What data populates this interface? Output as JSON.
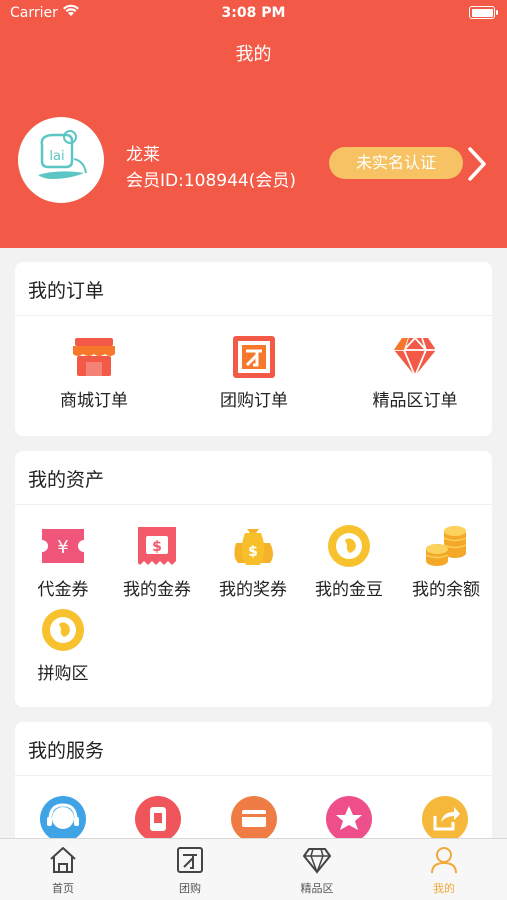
{
  "status_bar": {
    "carrier": "Carrier",
    "time": "3:08 PM"
  },
  "header": {
    "title": "我的"
  },
  "user": {
    "name": "龙莱",
    "member_id": "会员ID:108944(会员)",
    "verify_label": "未实名认证",
    "avatar_text": "lai"
  },
  "orders": {
    "title": "我的订单",
    "items": [
      {
        "label": "商城订单",
        "icon": "shop-icon"
      },
      {
        "label": "团购订单",
        "icon": "group-buy-icon"
      },
      {
        "label": "精品区订单",
        "icon": "diamond-icon"
      }
    ]
  },
  "assets": {
    "title": "我的资产",
    "items": [
      {
        "label": "代金券",
        "icon": "voucher-icon"
      },
      {
        "label": "我的金券",
        "icon": "gold-ticket-icon"
      },
      {
        "label": "我的奖券",
        "icon": "money-bags-icon"
      },
      {
        "label": "我的金豆",
        "icon": "gold-bean-icon"
      },
      {
        "label": "我的余额",
        "icon": "coins-icon"
      },
      {
        "label": "拼购区",
        "icon": "group-purchase-icon"
      }
    ]
  },
  "services": {
    "title": "我的服务",
    "items": [
      {
        "icon": "customer-service-icon"
      },
      {
        "icon": "phone-icon"
      },
      {
        "icon": "card-icon"
      },
      {
        "icon": "star-icon"
      },
      {
        "icon": "share-icon"
      }
    ]
  },
  "tabbar": {
    "items": [
      {
        "label": "首页",
        "icon": "home-icon"
      },
      {
        "label": "团购",
        "icon": "group-buy-tab-icon"
      },
      {
        "label": "精品区",
        "icon": "diamond-tab-icon"
      },
      {
        "label": "我的",
        "icon": "person-icon",
        "active": true
      }
    ]
  },
  "colors": {
    "header_bg": "#f25a47",
    "accent_orange": "#f0a93a",
    "verify_badge": "#f6c264"
  }
}
